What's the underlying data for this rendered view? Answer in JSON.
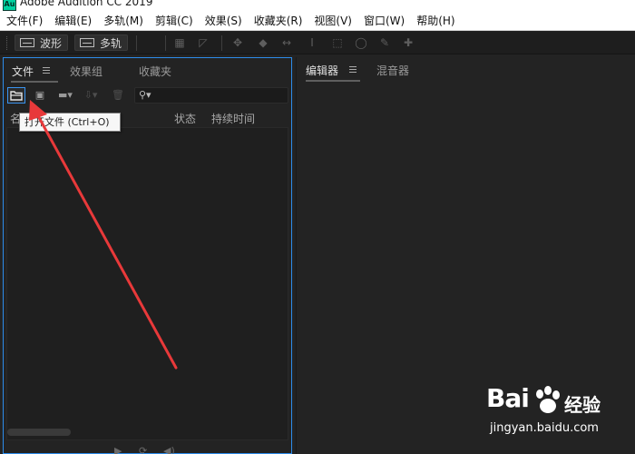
{
  "window": {
    "app_icon": "Au",
    "title": "Adobe Audition CC 2019"
  },
  "menu": [
    "文件(F)",
    "编辑(E)",
    "多轨(M)",
    "剪辑(C)",
    "效果(S)",
    "收藏夹(R)",
    "视图(V)",
    "窗口(W)",
    "帮助(H)"
  ],
  "toolbar": {
    "waveform_label": "波形",
    "multitrack_label": "多轨"
  },
  "files_panel": {
    "tabs": [
      "文件",
      "效果组",
      "收藏夹"
    ],
    "columns": {
      "name": "名",
      "status": "状态",
      "duration": "持续时间"
    },
    "search_placeholder": ""
  },
  "tooltip": {
    "text": "打开文件 (Ctrl+O)"
  },
  "editor_panel": {
    "tabs": [
      "编辑器",
      "混音器"
    ]
  },
  "watermark": {
    "brand": "Bai",
    "brand_suffix": "经验",
    "url": "jingyan.baidu.com"
  },
  "colors": {
    "accent": "#2d8ceb",
    "arrow": "#e8393a",
    "background": "#232323"
  }
}
